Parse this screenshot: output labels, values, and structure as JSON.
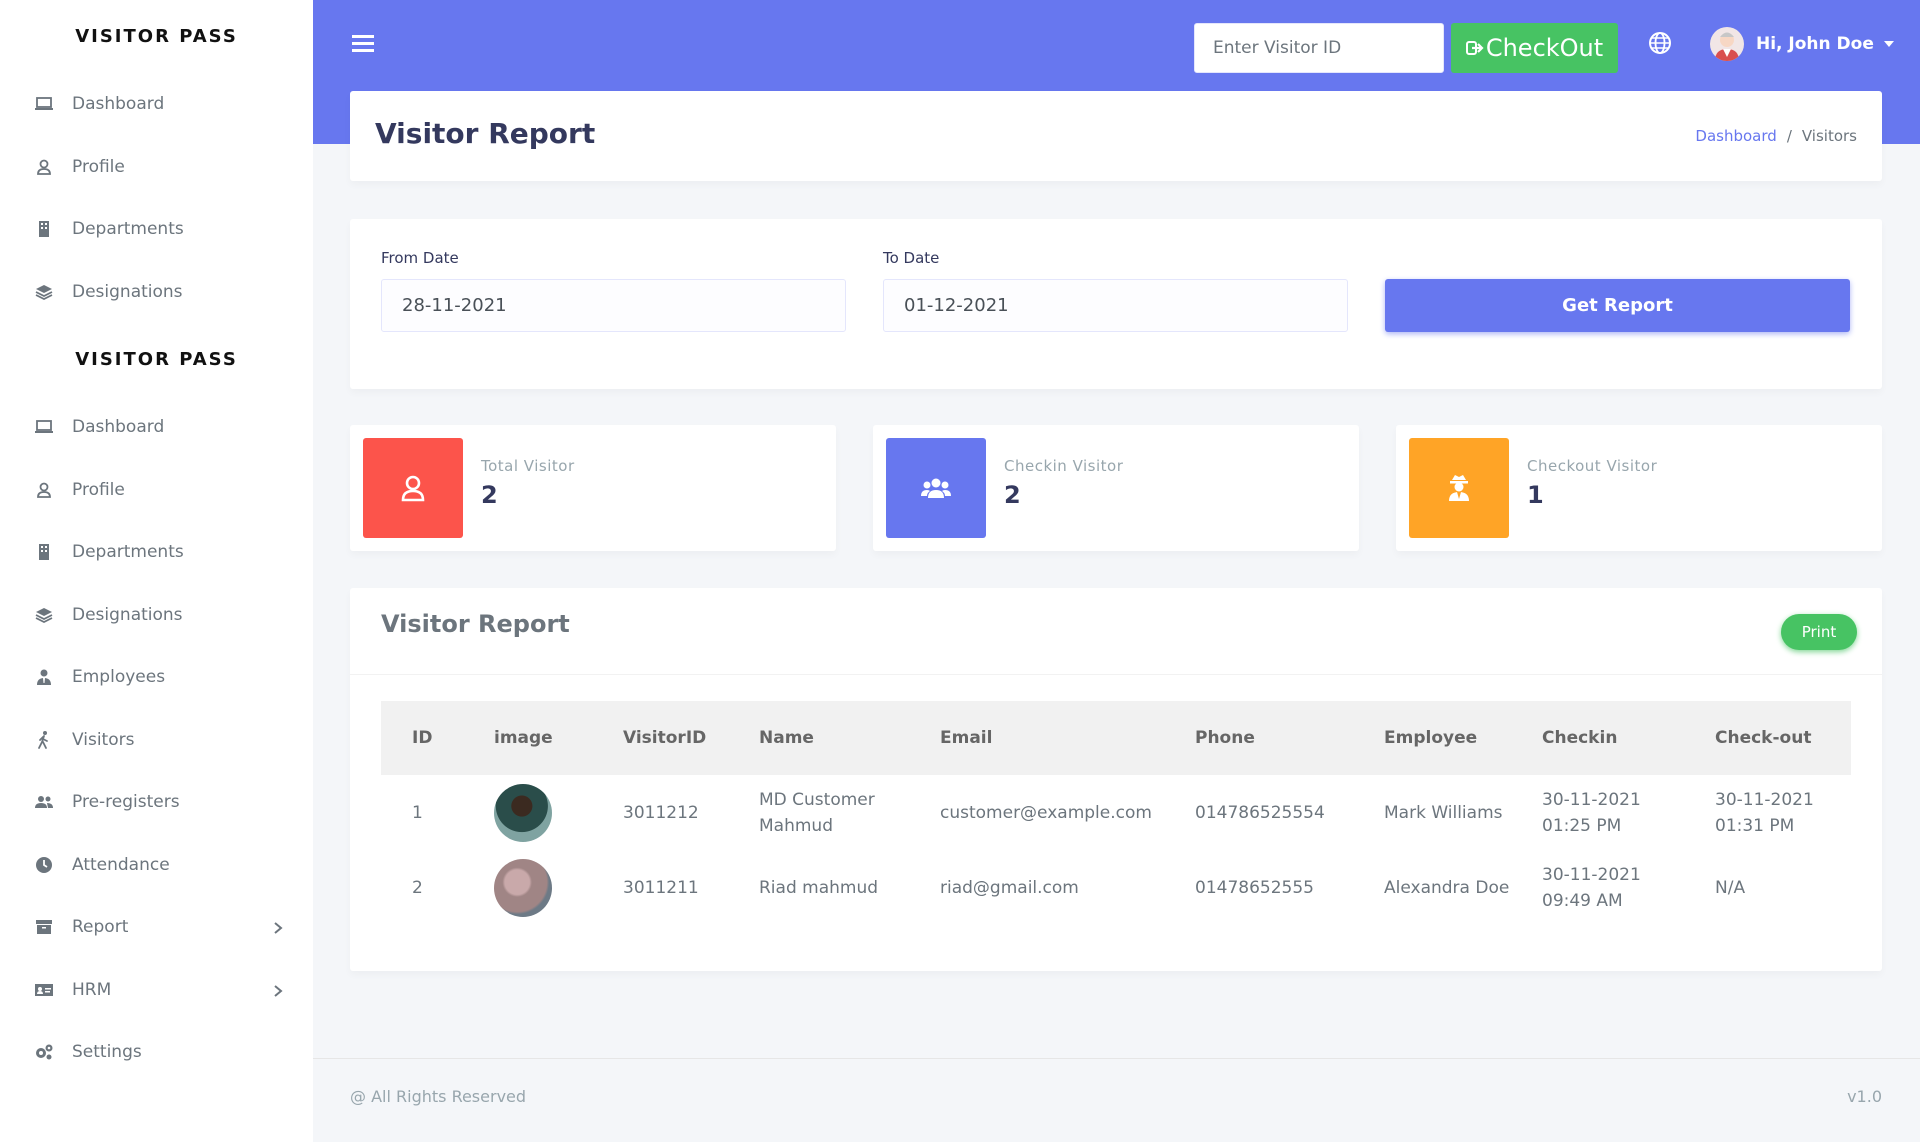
{
  "sidebar": {
    "brand": "VISITOR PASS",
    "group1": [
      {
        "label": "Dashboard"
      },
      {
        "label": "Profile"
      },
      {
        "label": "Departments"
      },
      {
        "label": "Designations"
      }
    ],
    "brand2": "VISITOR PASS",
    "group2": [
      {
        "label": "Dashboard"
      },
      {
        "label": "Profile"
      },
      {
        "label": "Departments"
      },
      {
        "label": "Designations"
      },
      {
        "label": "Employees"
      },
      {
        "label": "Visitors"
      },
      {
        "label": "Pre-registers"
      },
      {
        "label": "Attendance"
      },
      {
        "label": "Report"
      },
      {
        "label": "HRM"
      },
      {
        "label": "Settings"
      }
    ]
  },
  "header": {
    "visitor_id_placeholder": "Enter Visitor ID",
    "checkout_label": "CheckOut",
    "user_greeting": "Hi, John Doe"
  },
  "page": {
    "title": "Visitor Report",
    "breadcrumb": {
      "link": "Dashboard",
      "separator": "/",
      "current": "Visitors"
    }
  },
  "filter": {
    "from_label": "From Date",
    "from_value": "28-11-2021",
    "to_label": "To Date",
    "to_value": "01-12-2021",
    "button": "Get Report"
  },
  "stats": [
    {
      "label": "Total Visitor",
      "value": "2",
      "color": "#fc544b",
      "icon": "user-icon"
    },
    {
      "label": "Checkin Visitor",
      "value": "2",
      "color": "#6777ef",
      "icon": "users-icon"
    },
    {
      "label": "Checkout Visitor",
      "value": "1",
      "color": "#ffa426",
      "icon": "user-secret-icon"
    }
  ],
  "report": {
    "title": "Visitor Report",
    "print_label": "Print",
    "columns": [
      "ID",
      "image",
      "VisitorID",
      "Name",
      "Email",
      "Phone",
      "Employee",
      "Checkin",
      "Check-out"
    ],
    "rows": [
      {
        "id": "1",
        "visitor_id": "3011212",
        "name": "MD Customer Mahmud",
        "email": "customer@example.com",
        "phone": "014786525554",
        "employee": "Mark Williams",
        "checkin": "30-11-2021 01:25 PM",
        "checkout": "30-11-2021 01:31 PM"
      },
      {
        "id": "2",
        "visitor_id": "3011211",
        "name": "Riad mahmud",
        "email": "riad@gmail.com",
        "phone": "01478652555",
        "employee": "Alexandra Doe",
        "checkin": "30-11-2021 09:49 AM",
        "checkout": "N/A"
      }
    ]
  },
  "footer": {
    "left": "@ All Rights Reserved",
    "right": "v1.0"
  },
  "colors": {
    "primary": "#6777ef",
    "success": "#47c363",
    "danger": "#fc544b",
    "warning": "#ffa426"
  }
}
